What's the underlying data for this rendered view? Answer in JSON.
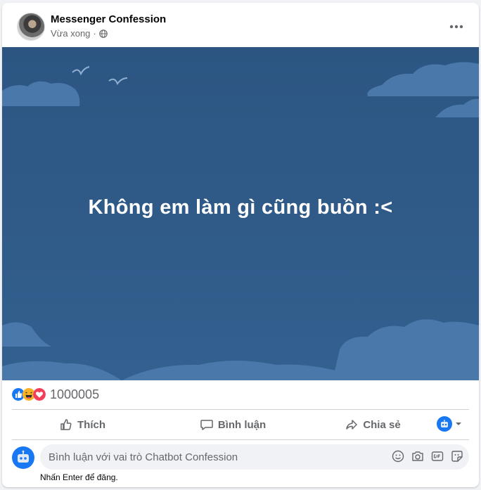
{
  "post": {
    "page_name": "Messenger Confession",
    "time": "Vừa xong",
    "separator": "·",
    "image_text": "Không em làm gì cũng buồn :<"
  },
  "reactions": {
    "count": "1000005",
    "icons": [
      "like-icon",
      "haha-icon",
      "love-icon"
    ],
    "colors": {
      "like": "#1877f2",
      "haha": "#f7b125",
      "love": "#f33e58"
    }
  },
  "actions": {
    "like_label": "Thích",
    "comment_label": "Bình luận",
    "share_label": "Chia sẻ"
  },
  "comment": {
    "placeholder": "Bình luận với vai trò Chatbot Confession",
    "hint": "Nhấn Enter để đăng.",
    "tools": [
      "emoji-icon",
      "camera-icon",
      "gif-icon",
      "sticker-icon"
    ]
  },
  "theme": {
    "accent": "#1877f2",
    "image_bg": "#2f5a86",
    "cloud": "#4a78ab"
  }
}
